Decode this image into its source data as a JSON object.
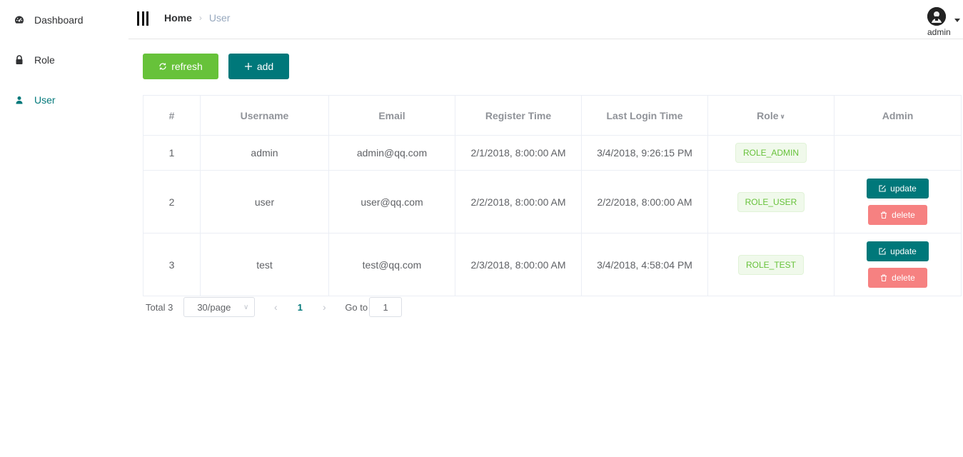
{
  "sidebar": {
    "items": [
      {
        "label": "Dashboard",
        "icon": "dashboard-icon"
      },
      {
        "label": "Role",
        "icon": "lock-icon"
      },
      {
        "label": "User",
        "icon": "user-icon",
        "active": true
      }
    ]
  },
  "header": {
    "breadcrumb": {
      "home": "Home",
      "current": "User"
    },
    "user": {
      "name": "admin"
    }
  },
  "toolbar": {
    "refresh_label": "refresh",
    "add_label": "add"
  },
  "table": {
    "columns": [
      "#",
      "Username",
      "Email",
      "Register Time",
      "Last Login Time",
      "Role",
      "Admin"
    ],
    "rows": [
      {
        "id": "1",
        "username": "admin",
        "email": "admin@qq.com",
        "register": "2/1/2018, 8:00:00 AM",
        "last_login": "3/4/2018, 9:26:15 PM",
        "role": "ROLE_ADMIN"
      },
      {
        "id": "2",
        "username": "user",
        "email": "user@qq.com",
        "register": "2/2/2018, 8:00:00 AM",
        "last_login": "2/2/2018, 8:00:00 AM",
        "role": "ROLE_USER"
      },
      {
        "id": "3",
        "username": "test",
        "email": "test@qq.com",
        "register": "2/3/2018, 8:00:00 AM",
        "last_login": "3/4/2018, 4:58:04 PM",
        "role": "ROLE_TEST"
      }
    ],
    "update_label": "update",
    "delete_label": "delete"
  },
  "pagination": {
    "total": "Total 3",
    "page_size": "30/page",
    "current_page": "1",
    "goto_label": "Go to",
    "goto_value": "1"
  },
  "colors": {
    "accent": "#00787a",
    "success": "#67c23a",
    "danger": "#f56c6c"
  }
}
